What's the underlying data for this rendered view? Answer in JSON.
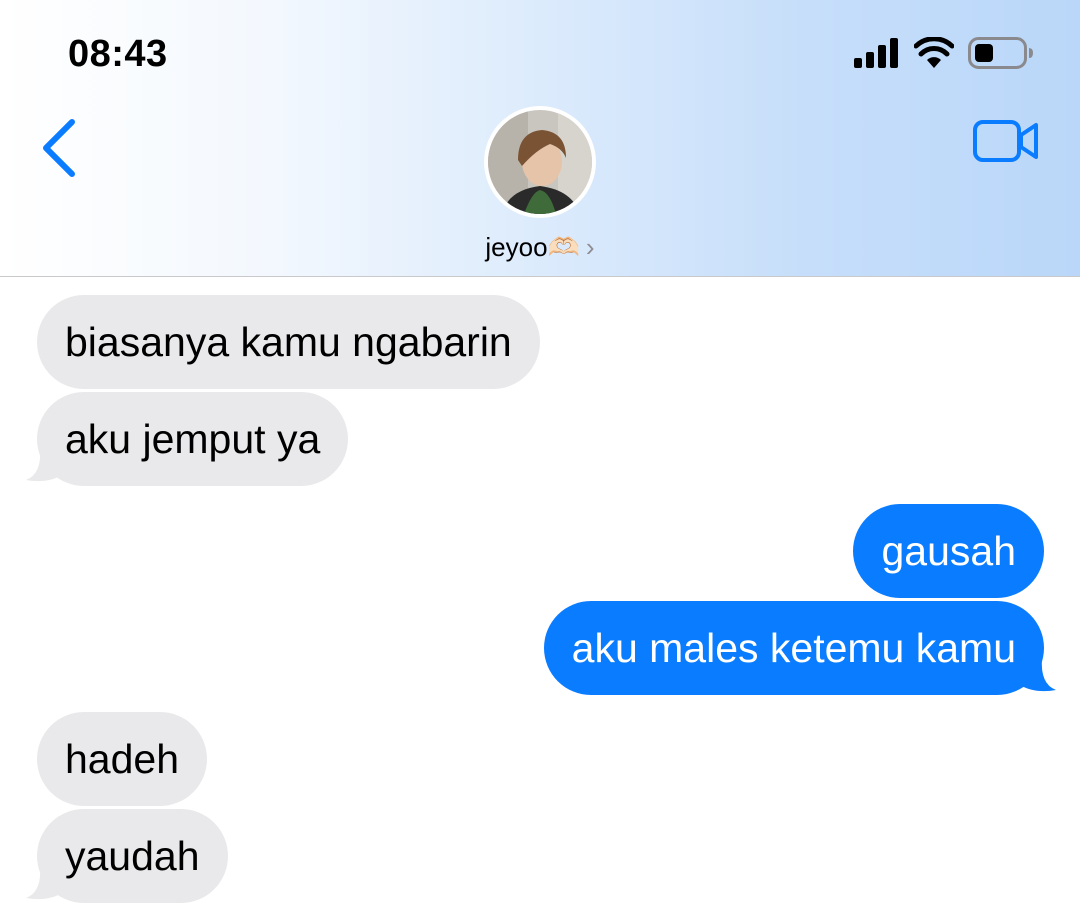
{
  "status_bar": {
    "time": "08:43",
    "signal_icon": "cellular-signal-icon",
    "wifi_icon": "wifi-icon",
    "battery_icon": "battery-icon"
  },
  "header": {
    "contact_name": "jeyoo🫶🏻",
    "back_icon": "chevron-left-icon",
    "video_icon": "video-camera-icon",
    "chevron": "›"
  },
  "colors": {
    "accent": "#0a7cff",
    "incoming_bubble": "#e9e9eb",
    "outgoing_bubble": "#0a7cff"
  },
  "messages": [
    {
      "direction": "incoming",
      "text": "biasanya kamu ngabarin"
    },
    {
      "direction": "incoming",
      "text": "aku jemput ya"
    },
    {
      "direction": "outgoing",
      "text": "gausah"
    },
    {
      "direction": "outgoing",
      "text": "aku males ketemu kamu"
    },
    {
      "direction": "incoming",
      "text": "hadeh"
    },
    {
      "direction": "incoming",
      "text": "yaudah"
    }
  ]
}
